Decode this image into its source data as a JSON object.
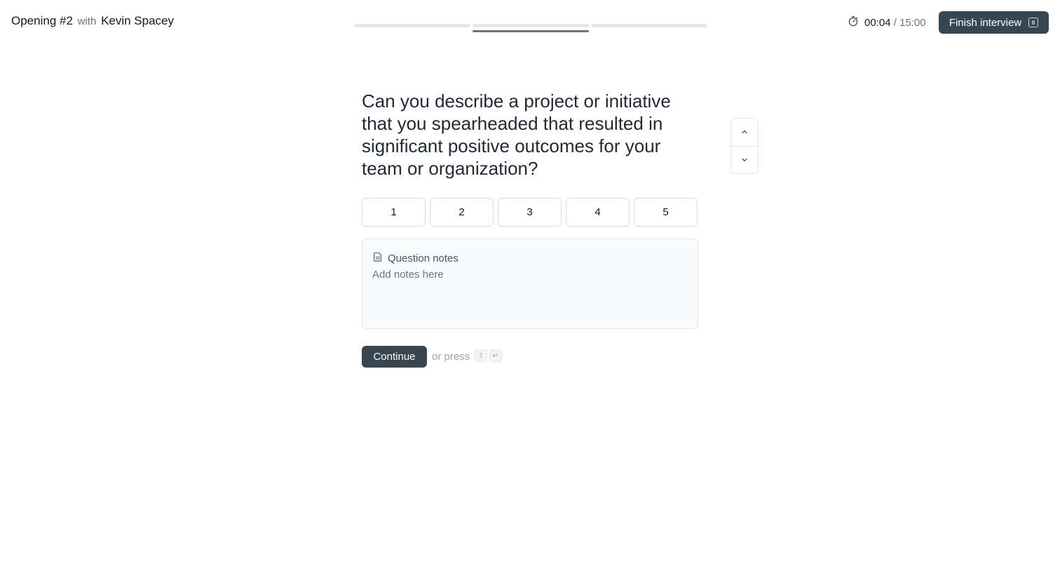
{
  "header": {
    "opening": "Opening #2",
    "with_word": "with",
    "candidate": "Kevin Spacey",
    "progress": {
      "total_segments": 3,
      "current_segment": 2
    },
    "timer": {
      "elapsed": "00:04",
      "separator": "/",
      "total": "15:00",
      "icon": "stopwatch-icon"
    },
    "finish_label": "Finish interview",
    "finish_shortcut_icon": "keyboard-shortcut-icon"
  },
  "question": {
    "text": "Can you describe a project or initiative that you spearheaded that resulted in significant positive outcomes for your team or organization?",
    "nav_up_icon": "chevron-up-icon",
    "nav_down_icon": "chevron-down-icon"
  },
  "ratings": [
    "1",
    "2",
    "3",
    "4",
    "5"
  ],
  "notes": {
    "label": "Question notes",
    "icon": "document-icon",
    "placeholder": "Add notes here",
    "value": ""
  },
  "actions": {
    "continue_label": "Continue",
    "or_press": "or press",
    "shortcut_keys": [
      "⇧",
      "↵"
    ]
  },
  "colors": {
    "primary_button": "#374651",
    "progress_track": "#e5e7eb",
    "progress_active": "#6b7280"
  }
}
